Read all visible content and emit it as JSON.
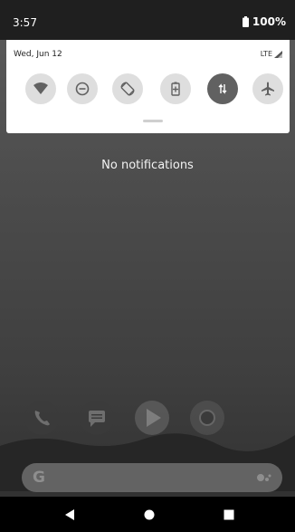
{
  "status_bar": {
    "time": "3:57",
    "battery_percent": "100%",
    "icons": [
      "battery-icon"
    ]
  },
  "quick_settings": {
    "date": "Wed, Jun 12",
    "network_type": "LTE",
    "tiles": [
      {
        "name": "wifi",
        "icon": "wifi-icon",
        "active": false
      },
      {
        "name": "do-not-disturb",
        "icon": "do-not-disturb-icon",
        "active": false
      },
      {
        "name": "auto-rotate",
        "icon": "auto-rotate-icon",
        "active": false
      },
      {
        "name": "battery-saver",
        "icon": "battery-saver-icon",
        "active": false
      },
      {
        "name": "mobile-data",
        "icon": "mobile-data-icon",
        "active": true
      },
      {
        "name": "airplane-mode",
        "icon": "airplane-icon",
        "active": false
      }
    ]
  },
  "notifications": {
    "empty_text": "No notifications"
  },
  "dock": {
    "apps": [
      "phone-icon",
      "messages-icon",
      "play-store-icon",
      "chrome-icon"
    ]
  },
  "search": {
    "logo": "G"
  },
  "nav": {
    "buttons": [
      "back-icon",
      "home-icon",
      "recents-icon"
    ]
  },
  "colors": {
    "status_bar": "#1f1f1f",
    "panel": "#ffffff",
    "tile_inactive": "#dedede",
    "tile_active": "#616161",
    "wallpaper": "#4a4a4a"
  }
}
